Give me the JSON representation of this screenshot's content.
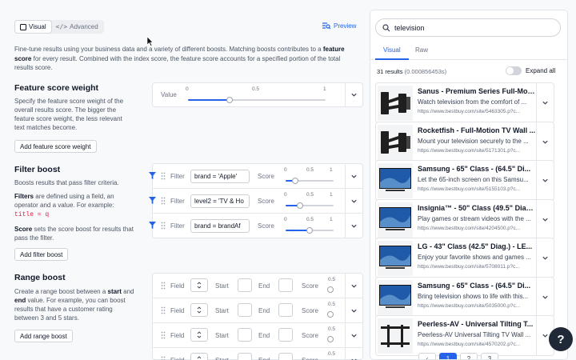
{
  "tabs": {
    "visual": "Visual",
    "advanced": "Advanced"
  },
  "preview_label": "Preview",
  "intro": {
    "p1": "Fine-tune results using your business data and a variety of different boosts. Matching boosts contributes to a",
    "bold": "feature score",
    "p2": "for every result. Combined with the index score, the feature score accounts for a specified portion of the total results score."
  },
  "feature_weight": {
    "title": "Feature score weight",
    "desc": "Specify the feature score weight of the overall results score. The bigger the feature score weight, the less relevant text matches become.",
    "button": "Add feature score weight",
    "value_label": "Value",
    "ticks": [
      "0",
      "0.5",
      "1"
    ],
    "value": 0.3
  },
  "filter_boost": {
    "title": "Filter boost",
    "desc1": "Boosts results that pass filter criteria.",
    "desc2_bold": "Filters",
    "desc2": "are defined using a field, an operator and a value. For example:",
    "code": "title = q",
    "desc3_bold": "Score",
    "desc3": "sets the score boost for results that pass the filter.",
    "button": "Add filter boost",
    "filter_label": "Filter",
    "score_label": "Score",
    "ticks": [
      "0",
      "0.5",
      "1"
    ],
    "rows": [
      {
        "filter": "brand = 'Apple'",
        "score": 0.2
      },
      {
        "filter": "level2 = 'TV & Ho",
        "score": 0.3
      },
      {
        "filter": "brand = brandAf",
        "score": 0.5
      }
    ]
  },
  "range_boost": {
    "title": "Range boost",
    "desc_a": "Create a range boost between a",
    "start_bold": "start",
    "desc_b": "and",
    "end_bold": "end",
    "desc_c": "value. For example, you can boost results that have a customer rating between 3 and 5 stars.",
    "button": "Add range boost",
    "field_label": "Field",
    "start_label": "Start",
    "end_label": "End",
    "score_label": "Score",
    "tick": "0.5"
  },
  "search": {
    "value": "television"
  },
  "result_tabs": {
    "visual": "Visual",
    "raw": "Raw"
  },
  "results_count": "31 results",
  "results_time": "(0.000856453s)",
  "expand_all": "Expand all",
  "results": [
    {
      "title": "Sanus - Premium Series Full-Mot...",
      "desc": "Watch television from the comfort of ...",
      "url": "https://www.bestbuy.com/site/5463305.p?c...",
      "thumb": "mount"
    },
    {
      "title": "Rocketfish - Full-Motion TV Wall ...",
      "desc": "Mount your television securely to the ...",
      "url": "https://www.bestbuy.com/site/5171301.p?c...",
      "thumb": "mount"
    },
    {
      "title": "Samsung - 65\" Class - (64.5\" Di...",
      "desc": "Let the 65-inch screen on this Samsu...",
      "url": "https://www.bestbuy.com/site/5155103.p?c...",
      "thumb": "tv"
    },
    {
      "title": "Insignia™ - 50\" Class (49.5\" Diag...",
      "desc": "Play games or stream videos with the ...",
      "url": "https://www.bestbuy.com/site/4204500.p?c...",
      "thumb": "tv"
    },
    {
      "title": "LG - 43\" Class (42.5\" Diag.) - LE...",
      "desc": "Enjoy your favorite shows and games ...",
      "url": "https://www.bestbuy.com/site/5708011.p?c...",
      "thumb": "tv"
    },
    {
      "title": "Samsung - 65\" Class - (64.5\" Di...",
      "desc": "Bring television shows to life with this...",
      "url": "https://www.bestbuy.com/site/5035000.p?c...",
      "thumb": "tv"
    },
    {
      "title": "Peerless-AV - Universal Tilting T...",
      "desc": "Peerless-AV Universal Tilting TV Wall ...",
      "url": "https://www.bestbuy.com/site/4570202.p?c...",
      "thumb": "bracket"
    }
  ],
  "pagination": {
    "pages": [
      "1",
      "2",
      "3"
    ],
    "current": "1"
  },
  "help_label": "?",
  "colors": {
    "accent": "#2563eb",
    "tv_screen": "#1e5aa8",
    "mount": "#1f1f1f"
  }
}
